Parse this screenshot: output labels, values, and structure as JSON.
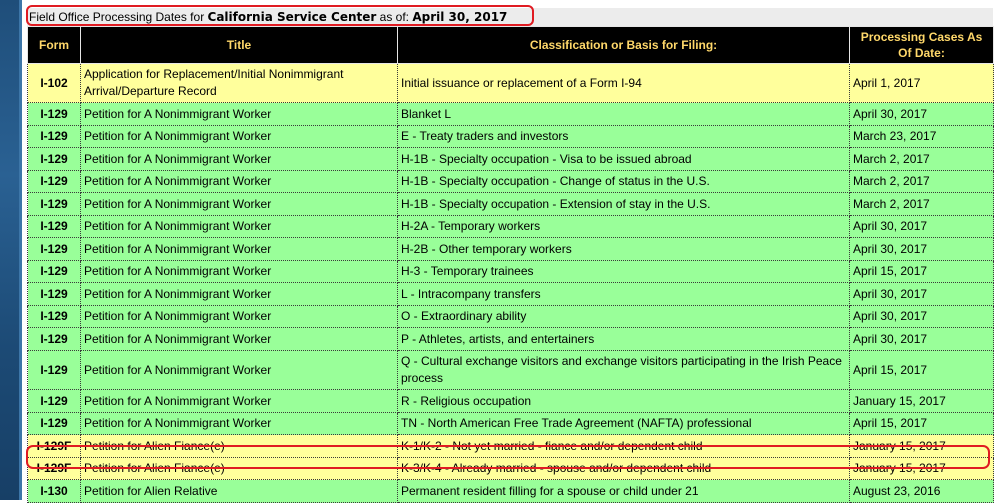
{
  "heading": {
    "prefix": "Field Office Processing Dates for ",
    "center": "California Service Center",
    "mid": " as of: ",
    "date": "April 30, 2017"
  },
  "columns": [
    "Form",
    "Title",
    "Classification or Basis for Filing:",
    "Processing Cases As Of Date:"
  ],
  "rows": [
    {
      "form": "I-102",
      "title": "Application for Replacement/Initial Nonimmigrant Arrival/Departure Record",
      "classification": "Initial issuance or replacement of a Form I-94",
      "date": "April 1, 2017"
    },
    {
      "form": "I-129",
      "title": "Petition for A Nonimmigrant Worker",
      "classification": "Blanket L",
      "date": "April 30, 2017"
    },
    {
      "form": "I-129",
      "title": "Petition for A Nonimmigrant Worker",
      "classification": "E - Treaty traders and investors",
      "date": "March 23, 2017"
    },
    {
      "form": "I-129",
      "title": "Petition for A Nonimmigrant Worker",
      "classification": "H-1B - Specialty occupation - Visa to be issued abroad",
      "date": "March 2, 2017"
    },
    {
      "form": "I-129",
      "title": "Petition for A Nonimmigrant Worker",
      "classification": "H-1B - Specialty occupation - Change of status in the U.S.",
      "date": "March 2, 2017"
    },
    {
      "form": "I-129",
      "title": "Petition for A Nonimmigrant Worker",
      "classification": "H-1B - Specialty occupation - Extension of stay in the U.S.",
      "date": "March 2, 2017"
    },
    {
      "form": "I-129",
      "title": "Petition for A Nonimmigrant Worker",
      "classification": "H-2A - Temporary workers",
      "date": "April 30, 2017"
    },
    {
      "form": "I-129",
      "title": "Petition for A Nonimmigrant Worker",
      "classification": "H-2B - Other temporary workers",
      "date": "April 30, 2017"
    },
    {
      "form": "I-129",
      "title": "Petition for A Nonimmigrant Worker",
      "classification": "H-3 - Temporary trainees",
      "date": "April 15, 2017"
    },
    {
      "form": "I-129",
      "title": "Petition for A Nonimmigrant Worker",
      "classification": "L - Intracompany transfers",
      "date": "April 30, 2017"
    },
    {
      "form": "I-129",
      "title": "Petition for A Nonimmigrant Worker",
      "classification": "O - Extraordinary ability",
      "date": "April 30, 2017"
    },
    {
      "form": "I-129",
      "title": "Petition for A Nonimmigrant Worker",
      "classification": "P - Athletes, artists, and entertainers",
      "date": "April 30, 2017"
    },
    {
      "form": "I-129",
      "title": "Petition for A Nonimmigrant Worker",
      "classification": "Q - Cultural exchange visitors and exchange visitors participating in the Irish Peace process",
      "date": "April 15, 2017"
    },
    {
      "form": "I-129",
      "title": "Petition for A Nonimmigrant Worker",
      "classification": "R - Religious occupation",
      "date": "January 15, 2017"
    },
    {
      "form": "I-129",
      "title": "Petition for A Nonimmigrant Worker",
      "classification": "TN - North American Free Trade Agreement (NAFTA) professional",
      "date": "April 15, 2017"
    },
    {
      "form": "I-129F",
      "title": "Petition for Alien Fiance(e)",
      "classification": "K-1/K-2 - Not yet married - fiance and/or dependent child",
      "date": "January 15, 2017"
    },
    {
      "form": "I-129F",
      "title": "Petition for Alien Fiance(e)",
      "classification": "K-3/K-4 - Already married - spouse and/or dependent child",
      "date": "January 15, 2017"
    },
    {
      "form": "I-130",
      "title": "Petition for Alien Relative",
      "classification": "Permanent resident filling for a spouse or child under 21",
      "date": "August 23, 2016"
    }
  ],
  "colors": {
    "header_bg": "#000000",
    "header_text": "#ffd86a",
    "row_yellow": "#ffff9c",
    "row_green": "#99ff99",
    "highlight_red": "#e01b22"
  }
}
